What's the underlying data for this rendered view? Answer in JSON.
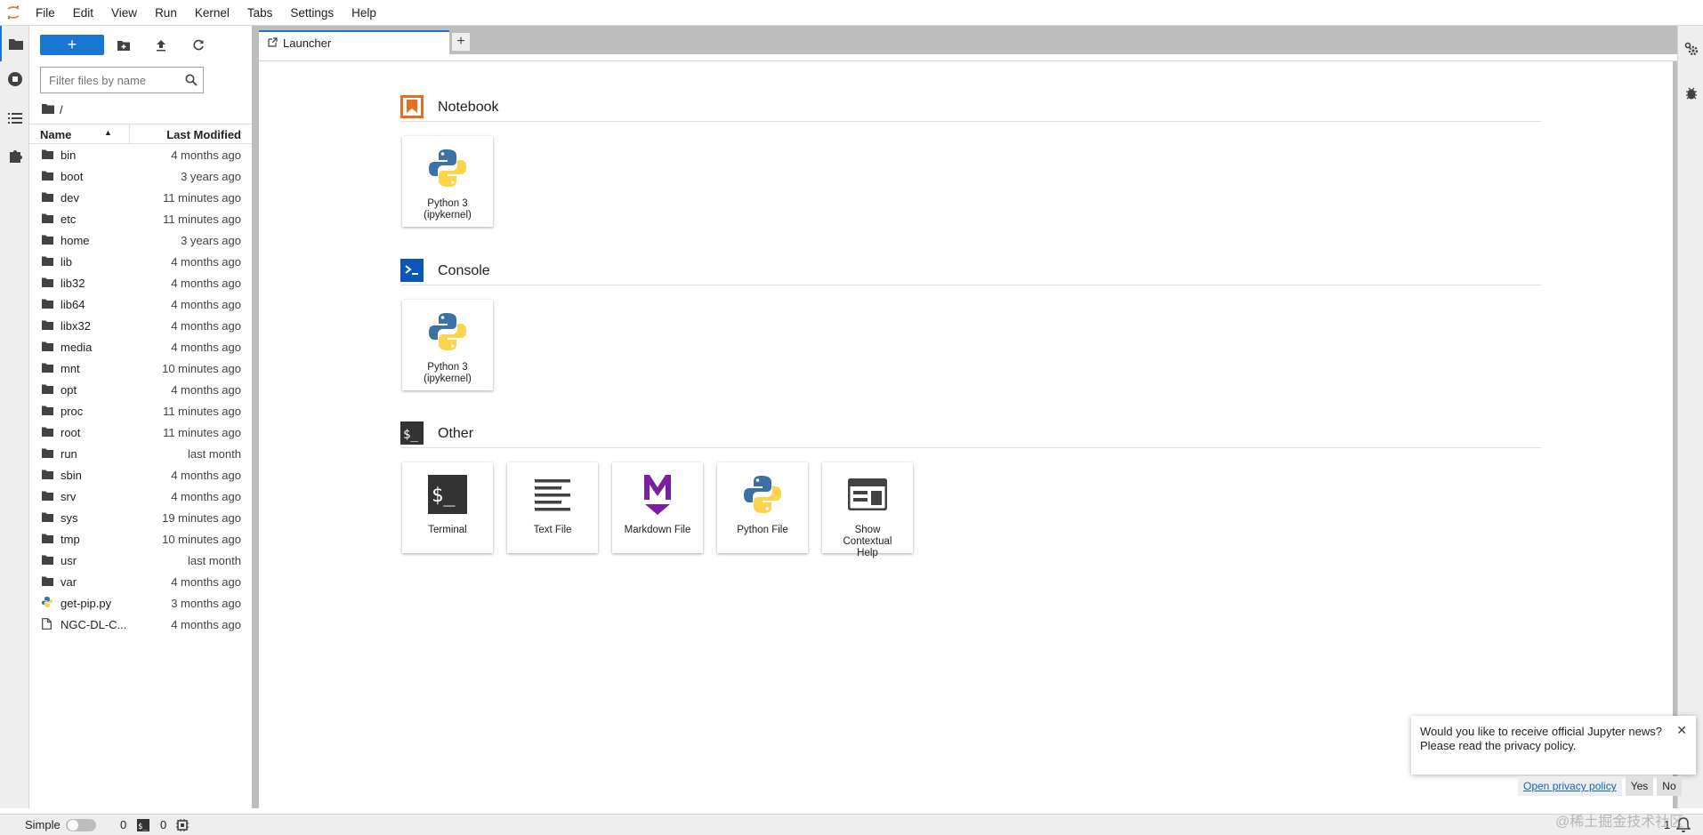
{
  "menu": [
    "File",
    "Edit",
    "View",
    "Run",
    "Kernel",
    "Tabs",
    "Settings",
    "Help"
  ],
  "file_browser": {
    "new_label": "+",
    "filter_placeholder": "Filter files by name",
    "breadcrumb": "/",
    "col_name": "Name",
    "col_modified": "Last Modified",
    "files": [
      {
        "name": "bin",
        "modified": "4 months ago",
        "type": "folder"
      },
      {
        "name": "boot",
        "modified": "3 years ago",
        "type": "folder"
      },
      {
        "name": "dev",
        "modified": "11 minutes ago",
        "type": "folder"
      },
      {
        "name": "etc",
        "modified": "11 minutes ago",
        "type": "folder"
      },
      {
        "name": "home",
        "modified": "3 years ago",
        "type": "folder"
      },
      {
        "name": "lib",
        "modified": "4 months ago",
        "type": "folder"
      },
      {
        "name": "lib32",
        "modified": "4 months ago",
        "type": "folder"
      },
      {
        "name": "lib64",
        "modified": "4 months ago",
        "type": "folder"
      },
      {
        "name": "libx32",
        "modified": "4 months ago",
        "type": "folder"
      },
      {
        "name": "media",
        "modified": "4 months ago",
        "type": "folder"
      },
      {
        "name": "mnt",
        "modified": "10 minutes ago",
        "type": "folder"
      },
      {
        "name": "opt",
        "modified": "4 months ago",
        "type": "folder"
      },
      {
        "name": "proc",
        "modified": "11 minutes ago",
        "type": "folder"
      },
      {
        "name": "root",
        "modified": "11 minutes ago",
        "type": "folder"
      },
      {
        "name": "run",
        "modified": "last month",
        "type": "folder"
      },
      {
        "name": "sbin",
        "modified": "4 months ago",
        "type": "folder"
      },
      {
        "name": "srv",
        "modified": "4 months ago",
        "type": "folder"
      },
      {
        "name": "sys",
        "modified": "19 minutes ago",
        "type": "folder"
      },
      {
        "name": "tmp",
        "modified": "10 minutes ago",
        "type": "folder"
      },
      {
        "name": "usr",
        "modified": "last month",
        "type": "folder"
      },
      {
        "name": "var",
        "modified": "4 months ago",
        "type": "folder"
      },
      {
        "name": "get-pip.py",
        "modified": "3 months ago",
        "type": "python"
      },
      {
        "name": "NGC-DL-C...",
        "modified": "4 months ago",
        "type": "file"
      }
    ]
  },
  "tab": {
    "label": "Launcher",
    "add_label": "+"
  },
  "launcher": {
    "notebook": {
      "title": "Notebook",
      "cards": [
        {
          "label": "Python 3 (ipykernel)",
          "icon": "python-icon"
        }
      ]
    },
    "console": {
      "title": "Console",
      "cards": [
        {
          "label": "Python 3 (ipykernel)",
          "icon": "python-icon"
        }
      ]
    },
    "other": {
      "title": "Other",
      "cards": [
        {
          "label": "Terminal",
          "icon": "terminal-icon"
        },
        {
          "label": "Text File",
          "icon": "text-file-icon"
        },
        {
          "label": "Markdown File",
          "icon": "markdown-icon"
        },
        {
          "label": "Python File",
          "icon": "python-icon"
        },
        {
          "label": "Show Contextual Help",
          "icon": "contextual-help-icon"
        }
      ]
    }
  },
  "status": {
    "mode": "Simple",
    "terminals": "0",
    "kernels": "0",
    "right_count": "1"
  },
  "notification": {
    "line1": "Would you like to receive official Jupyter news?",
    "line2": "Please read the privacy policy.",
    "close": "✕",
    "link": "Open privacy policy",
    "yes": "Yes",
    "no": "No"
  },
  "watermark": "@稀土掘金技术社区",
  "colors": {
    "accent": "#1976d2",
    "notebook_orange": "#e46f1f",
    "console_blue": "#0c56b8",
    "markdown_purple": "#7b1fa2"
  }
}
